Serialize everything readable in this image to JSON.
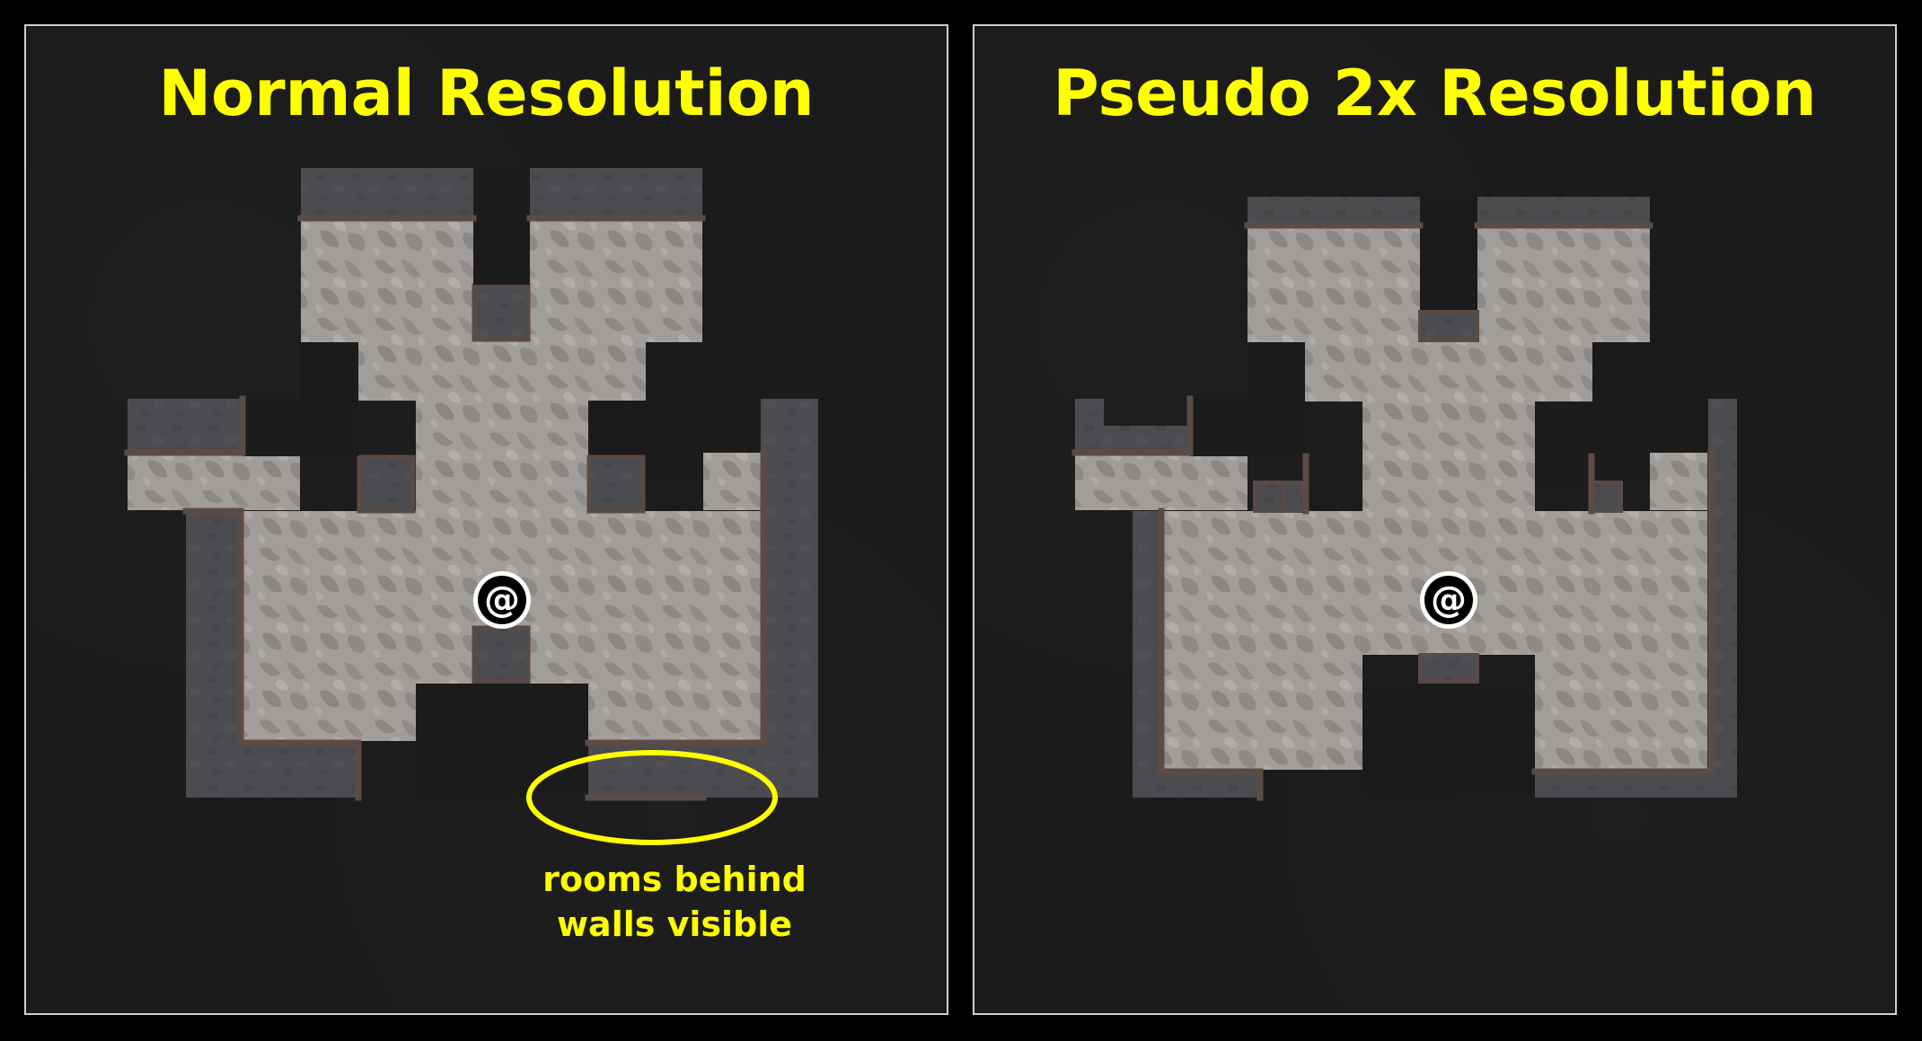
{
  "left_panel": {
    "title": "Normal Resolution",
    "player_glyph": "@",
    "annotation": {
      "line1": "rooms behind",
      "line2": "walls visible"
    }
  },
  "right_panel": {
    "title": "Pseudo 2x Resolution",
    "player_glyph": "@"
  },
  "colors": {
    "background": "#000000",
    "panel_fill": "#1b1b1b",
    "panel_border": "#cfcfcf",
    "floor": "#9f9b98",
    "floor_mottle": "#888482",
    "wall_top": "#4a4a4d",
    "wall_edge": "#5a4a44",
    "highlight": "#ffff00"
  },
  "icons": {
    "player": "at-sign-player-token",
    "annotation_marker": "ellipse-outline"
  }
}
